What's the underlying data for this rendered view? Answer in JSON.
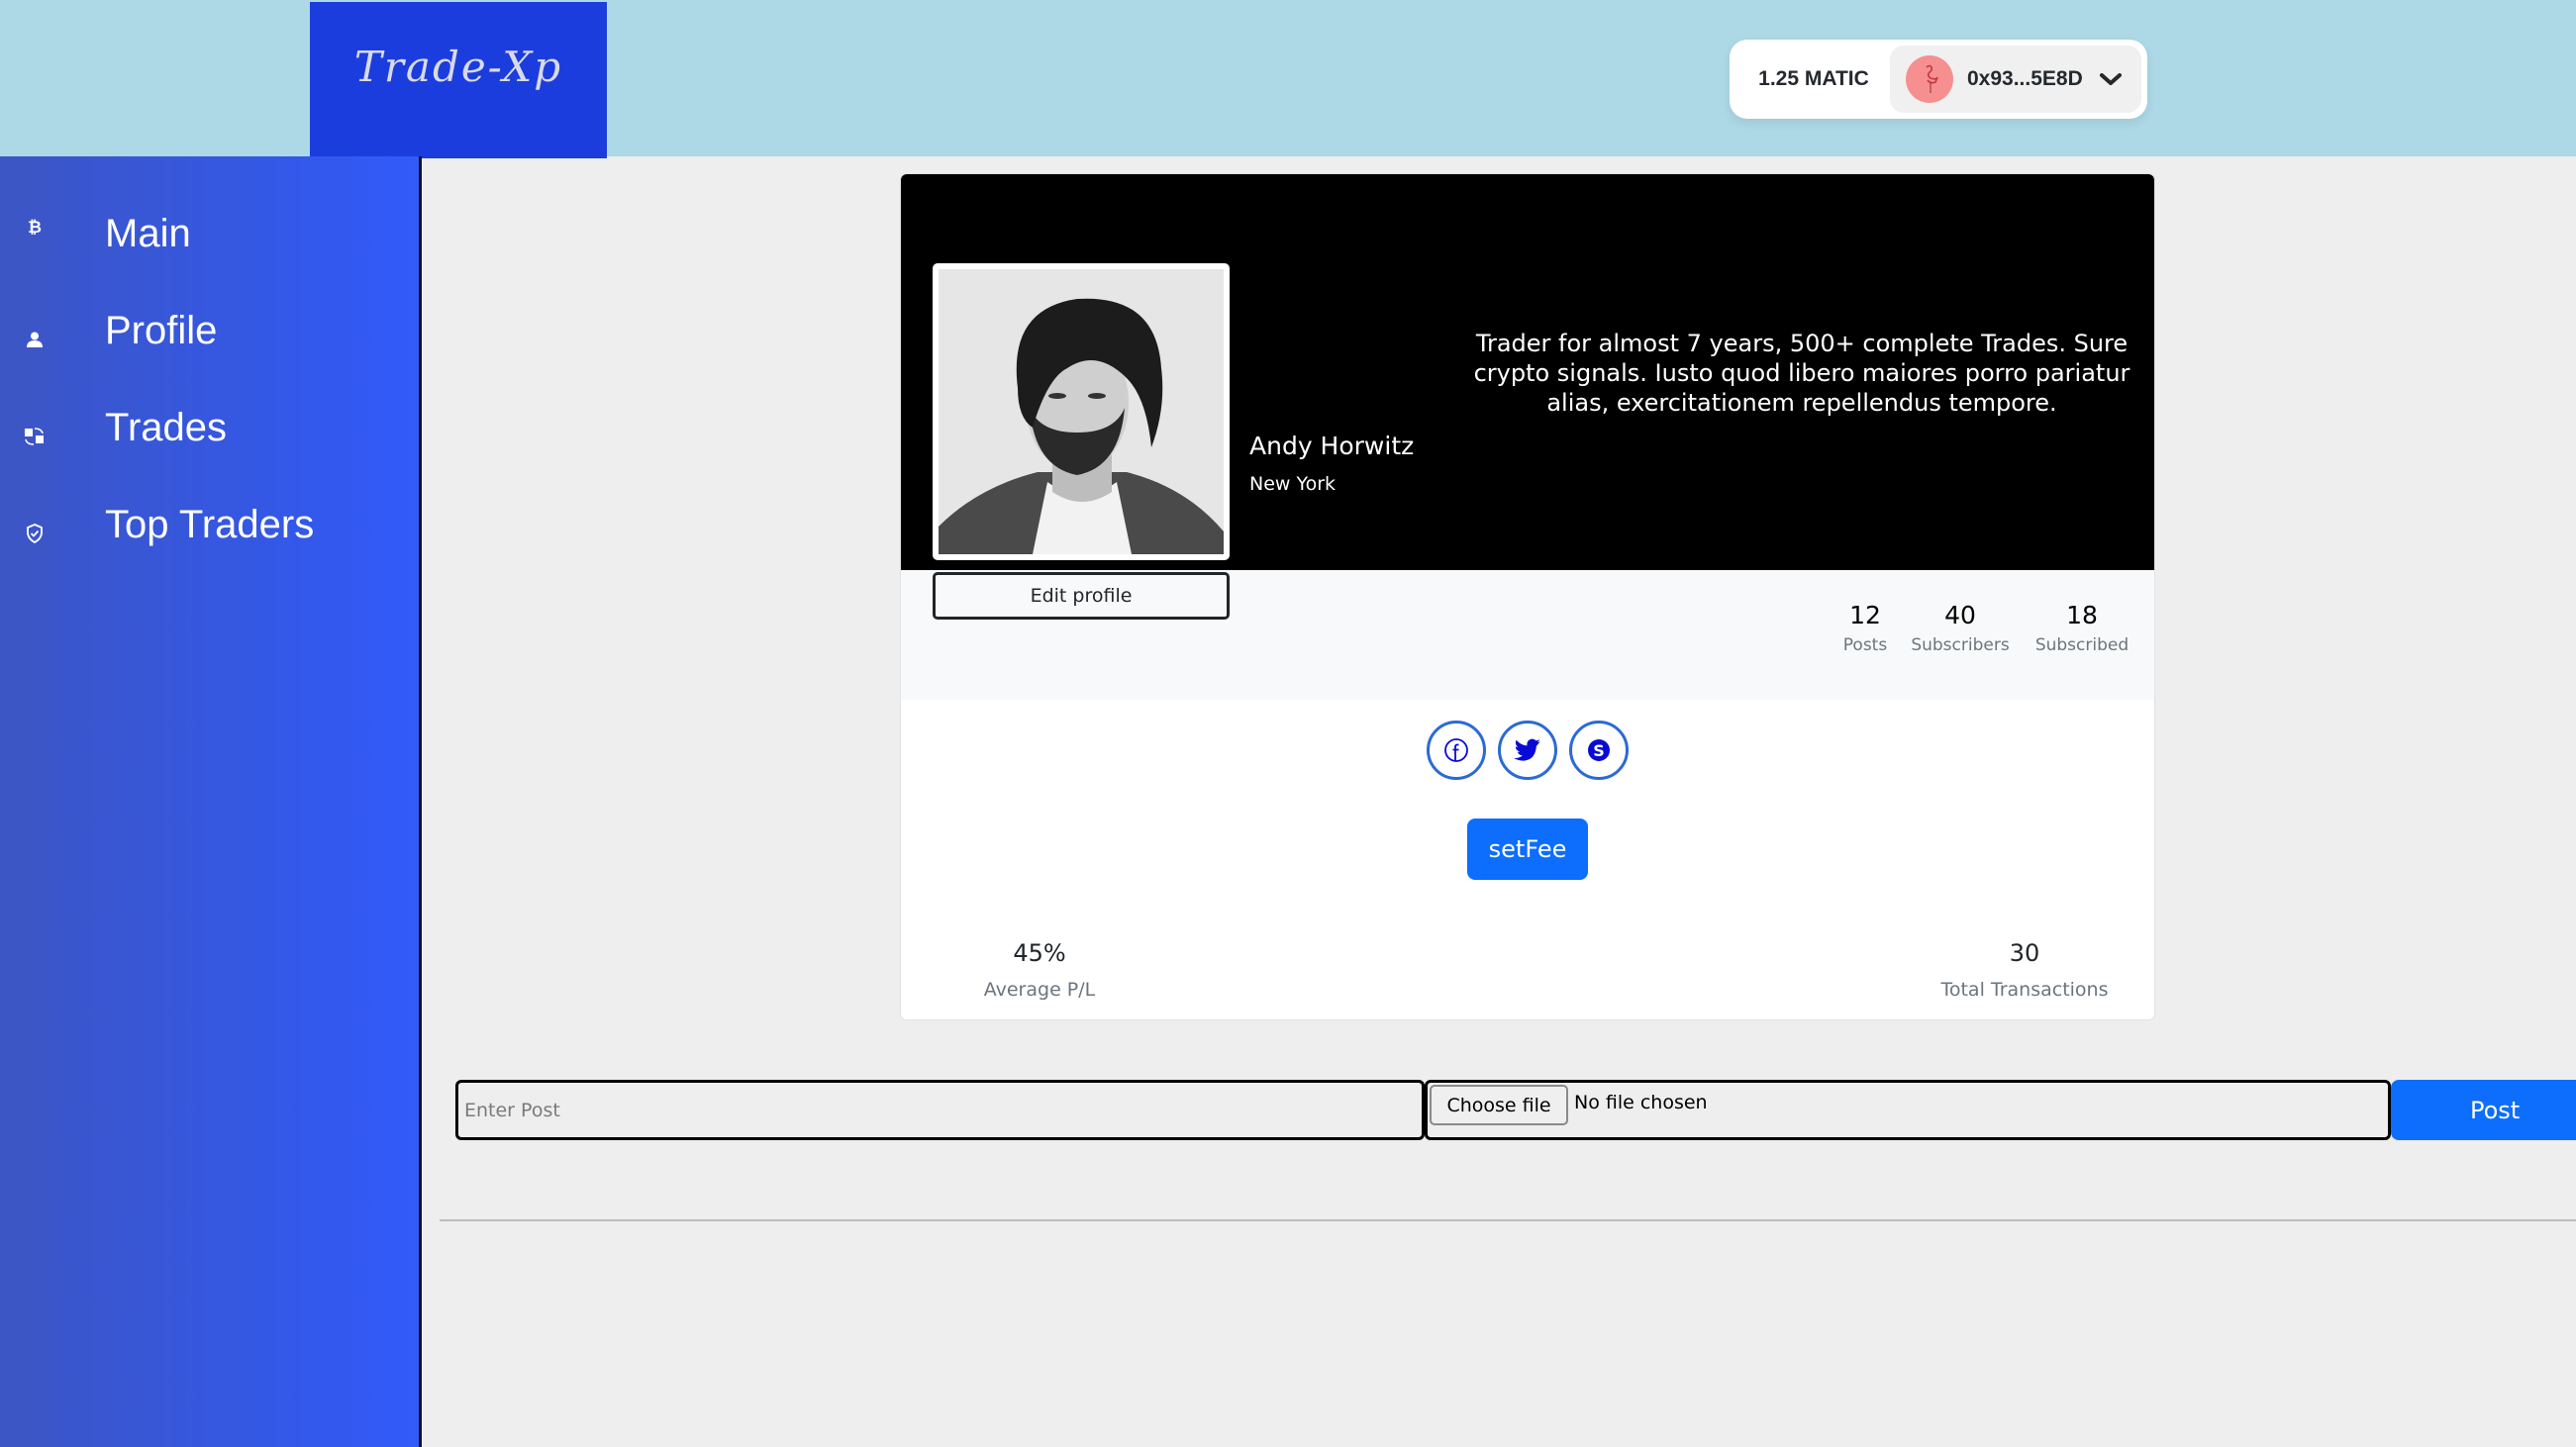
{
  "header": {
    "logo_text": "Trade-Xp",
    "wallet": {
      "balance": "1.25 MATIC",
      "avatar_icon": "flamingo-icon",
      "address": "0x93...5E8D",
      "dropdown_icon": "chevron-down-icon"
    }
  },
  "sidebar": {
    "items": [
      {
        "label": "Main",
        "icon": "bitcoin-icon"
      },
      {
        "label": "Profile",
        "icon": "user-icon"
      },
      {
        "label": "Trades",
        "icon": "exchange-icon"
      },
      {
        "label": "Top Traders",
        "icon": "shield-check-icon"
      }
    ]
  },
  "profile": {
    "name": "Andy Horwitz",
    "location": "New York",
    "bio": "Trader for almost 7 years, 500+ complete Trades. Sure crypto signals. Iusto quod libero maiores porro pariatur alias, exercitationem repellendus tempore.",
    "edit_label": "Edit profile",
    "stats": [
      {
        "value": "12",
        "label": "Posts"
      },
      {
        "value": "40",
        "label": "Subscribers"
      },
      {
        "value": "18",
        "label": "Subscribed"
      }
    ],
    "socials": [
      {
        "name": "facebook",
        "icon": "facebook-icon"
      },
      {
        "name": "twitter",
        "icon": "twitter-icon"
      },
      {
        "name": "skype",
        "icon": "skype-icon"
      }
    ],
    "setfee_label": "setFee",
    "metrics": {
      "avg_pl": {
        "value": "45%",
        "label": "Average P/L"
      },
      "total_tx": {
        "value": "30",
        "label": "Total Transactions"
      }
    }
  },
  "composer": {
    "post_placeholder": "Enter Post",
    "post_value": "",
    "choose_file_label": "Choose file",
    "file_status": "No file chosen",
    "post_label": "Post"
  },
  "colors": {
    "header_bg": "#add8e6",
    "logo_bg": "#1c3ddd",
    "sidebar_start": "#3d56c4",
    "sidebar_end": "#315bfa",
    "primary_button": "#0d6efd",
    "social_icon": "#0a0ad6"
  }
}
